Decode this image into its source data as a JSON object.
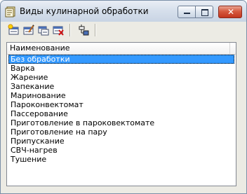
{
  "window": {
    "title": "Виды кулинарной обработки",
    "close_glyph": "✕"
  },
  "toolbar": {
    "buttons": [
      {
        "icon": "add-record-icon"
      },
      {
        "icon": "edit-record-icon"
      },
      {
        "icon": "copy-record-icon"
      },
      {
        "icon": "delete-record-icon"
      },
      {
        "icon": "hierarchy-icon"
      }
    ]
  },
  "list": {
    "column_header": "Наименование",
    "selected_index": 0,
    "selection_color": "#3399ff",
    "items": [
      "Без обработки",
      "Варка",
      "Жарение",
      "Запекание",
      "Маринование",
      "Пароконвектомат",
      "Пассерование",
      "Приготовление в пароковектомате",
      "Приготовление на пару",
      "Припускание",
      "СВЧ-нагрев",
      "Тушение"
    ]
  }
}
